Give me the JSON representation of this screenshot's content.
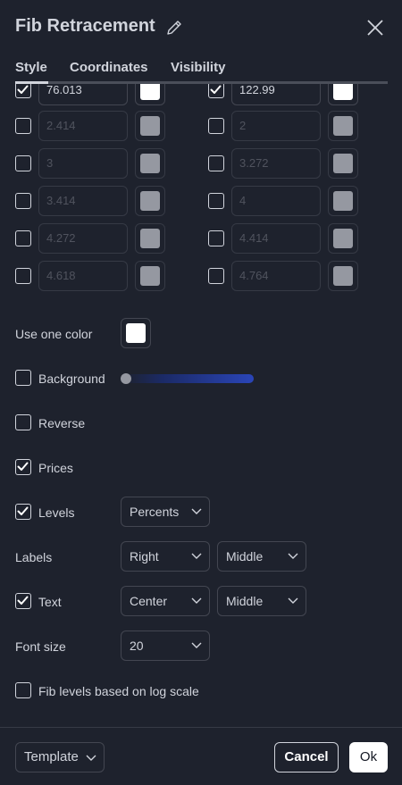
{
  "dialog": {
    "title": "Fib Retracement",
    "tabs": [
      "Style",
      "Coordinates",
      "Visibility"
    ],
    "active_tab": "Style"
  },
  "levels": [
    {
      "left": {
        "checked": true,
        "value": "76.013",
        "color": "#ffffff"
      },
      "right": {
        "checked": true,
        "value": "122.99",
        "color": "#ffffff"
      }
    },
    {
      "left": {
        "checked": false,
        "value": "2.414",
        "color": "#9598a1"
      },
      "right": {
        "checked": false,
        "value": "2",
        "color": "#9598a1"
      }
    },
    {
      "left": {
        "checked": false,
        "value": "3",
        "color": "#9598a1"
      },
      "right": {
        "checked": false,
        "value": "3.272",
        "color": "#9598a1"
      }
    },
    {
      "left": {
        "checked": false,
        "value": "3.414",
        "color": "#9598a1"
      },
      "right": {
        "checked": false,
        "value": "4",
        "color": "#9598a1"
      }
    },
    {
      "left": {
        "checked": false,
        "value": "4.272",
        "color": "#9598a1"
      },
      "right": {
        "checked": false,
        "value": "4.414",
        "color": "#9598a1"
      }
    },
    {
      "left": {
        "checked": false,
        "value": "4.618",
        "color": "#9598a1"
      },
      "right": {
        "checked": false,
        "value": "4.764",
        "color": "#9598a1"
      }
    }
  ],
  "options": {
    "use_one_color": {
      "label": "Use one color",
      "color": "#ffffff"
    },
    "background": {
      "label": "Background",
      "checked": false,
      "opacity_level": 0
    },
    "reverse": {
      "label": "Reverse",
      "checked": false
    },
    "prices": {
      "label": "Prices",
      "checked": true
    },
    "levels": {
      "label": "Levels",
      "checked": true,
      "value": "Percents"
    },
    "labels": {
      "label": "Labels",
      "horizontal": "Right",
      "vertical": "Middle"
    },
    "text": {
      "label": "Text",
      "checked": true,
      "horizontal": "Center",
      "vertical": "Middle"
    },
    "font_size": {
      "label": "Font size",
      "value": "20"
    },
    "log_scale": {
      "label": "Fib levels based on log scale",
      "checked": false
    }
  },
  "footer": {
    "template_label": "Template",
    "cancel_label": "Cancel",
    "ok_label": "Ok"
  }
}
